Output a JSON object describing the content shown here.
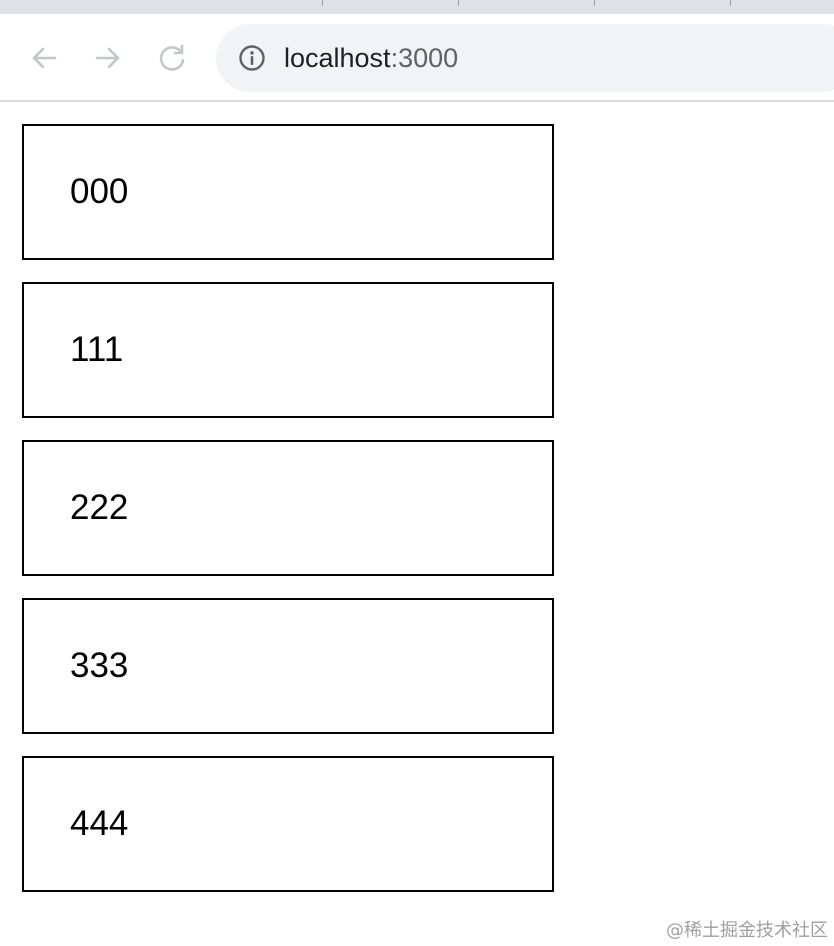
{
  "browser": {
    "url_host": "localhost",
    "url_port": ":3000",
    "icons": {
      "back": "arrow-left-icon",
      "forward": "arrow-right-icon",
      "reload": "reload-icon",
      "site_info": "info-icon"
    }
  },
  "items": [
    {
      "label": "000"
    },
    {
      "label": "111"
    },
    {
      "label": "222"
    },
    {
      "label": "333"
    },
    {
      "label": "444"
    }
  ],
  "watermark": "@稀土掘金技术社区",
  "colors": {
    "item_border": "#000000",
    "omnibox_bg": "#f1f3f4",
    "nav_icon": "#c4c7ca"
  }
}
